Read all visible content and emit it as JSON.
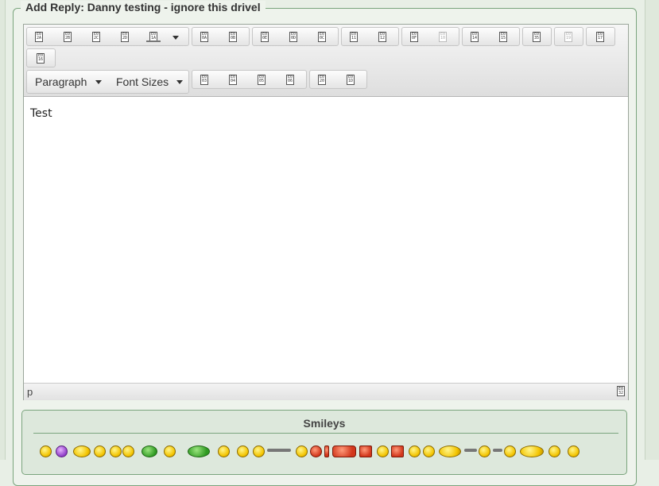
{
  "form": {
    "legend": "Add Reply: Danny testing - ignore this drivel"
  },
  "toolbar": {
    "row1_groups": [
      [
        "2A",
        "2B",
        "2C",
        "2D",
        "1A"
      ],
      [
        "0A",
        "0B"
      ],
      [
        "0E",
        "0D",
        "0C"
      ],
      [
        "11",
        "12"
      ],
      [
        "0F",
        "10"
      ],
      [
        "14",
        "15"
      ],
      [
        "35"
      ],
      [
        "19"
      ],
      [
        "17"
      ],
      [
        "16"
      ]
    ],
    "row2_groups": [
      [
        "03",
        "04",
        "05",
        "06"
      ],
      [
        "20",
        "1D"
      ]
    ],
    "format_select": "Paragraph",
    "fontsize_select": "Font Sizes",
    "resize_glyph": "32"
  },
  "editor": {
    "content": "Test",
    "path": "p"
  },
  "smileys": {
    "title": "Smileys"
  }
}
